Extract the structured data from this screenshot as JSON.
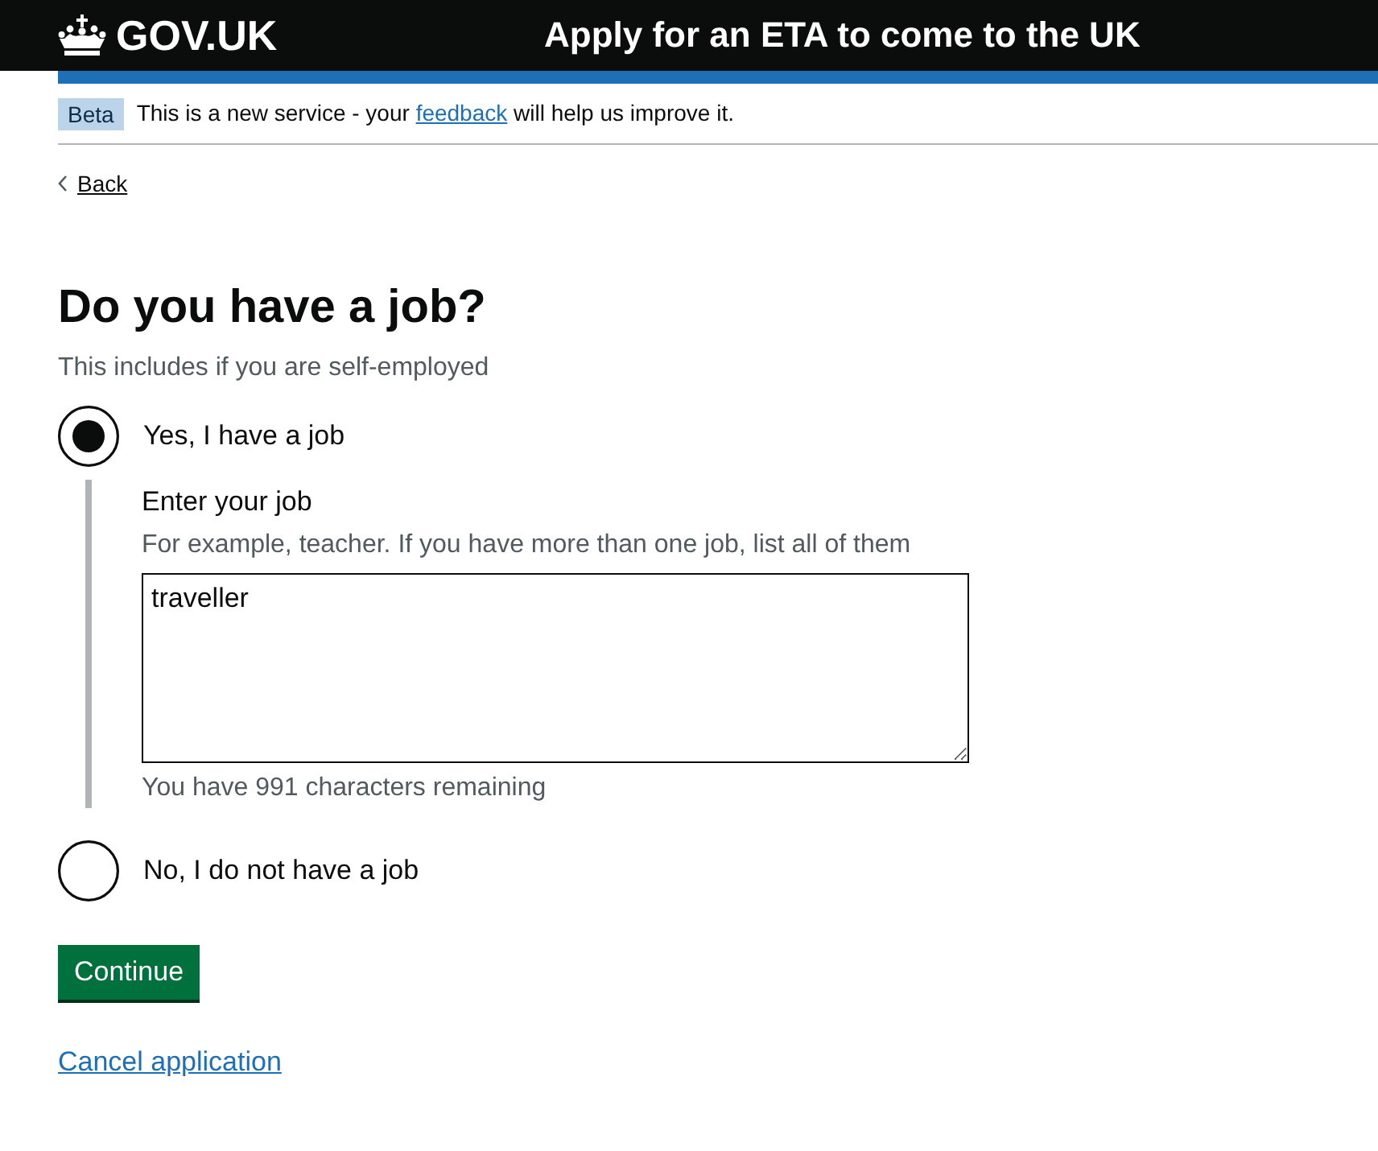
{
  "header": {
    "logo": "GOV.UK",
    "service_name": "Apply for an ETA to come to the UK"
  },
  "phase_banner": {
    "tag": "Beta",
    "text_start": "This is a new service - your ",
    "link": "feedback",
    "text_end": " will help us improve it."
  },
  "back_link": "Back",
  "question": {
    "title": "Do you have a job?",
    "hint": "This includes if you are self-employed"
  },
  "options": [
    {
      "label": "Yes, I have a job",
      "selected": true,
      "conditional": {
        "label": "Enter your job",
        "hint": "For example, teacher. If you have more than one job, list all of them",
        "value": "traveller",
        "counter": "You have 991 characters remaining"
      }
    },
    {
      "label": "No, I do not have a job",
      "selected": false
    }
  ],
  "continue_button": "Continue",
  "cancel_link": "Cancel application"
}
